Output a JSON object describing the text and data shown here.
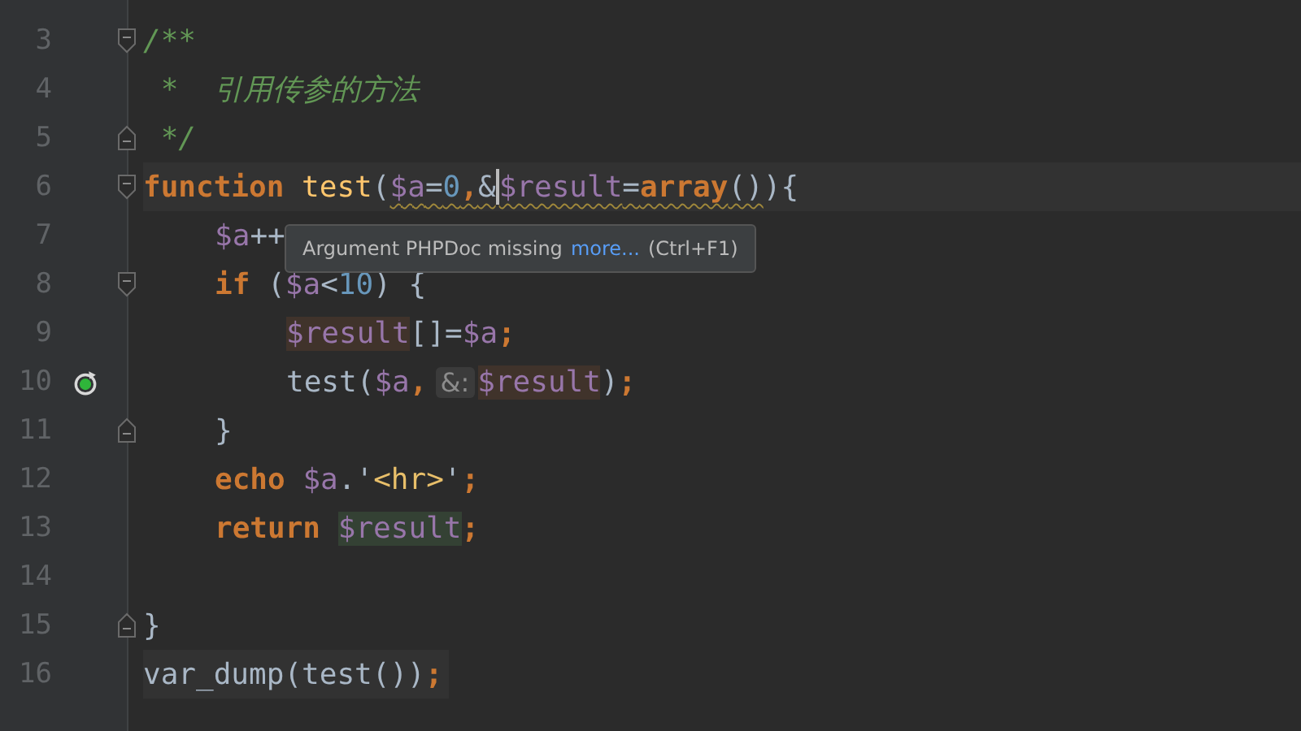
{
  "lines": [
    {
      "number": "3",
      "fold_start": true,
      "fold_end": false,
      "current": false,
      "shaded": false,
      "recursion_marker": false,
      "tokens": [
        {
          "text": "/**",
          "kind": "comment"
        }
      ]
    },
    {
      "number": "4",
      "fold_start": false,
      "fold_end": false,
      "current": false,
      "shaded": false,
      "recursion_marker": false,
      "tokens": [
        {
          "text": " *  引用传参的方法",
          "kind": "comment"
        }
      ]
    },
    {
      "number": "5",
      "fold_start": false,
      "fold_end": true,
      "current": false,
      "shaded": false,
      "recursion_marker": false,
      "tokens": [
        {
          "text": " */",
          "kind": "comment"
        }
      ]
    },
    {
      "number": "6",
      "fold_start": true,
      "fold_end": false,
      "current": true,
      "shaded": false,
      "recursion_marker": false,
      "tokens": [
        {
          "text": "function ",
          "kind": "keyword"
        },
        {
          "text": "test",
          "kind": "function"
        },
        {
          "text": "(",
          "kind": "plain"
        },
        {
          "text": "$a",
          "kind": "variable",
          "warn": true
        },
        {
          "text": "=",
          "kind": "plain",
          "warn": true
        },
        {
          "text": "0",
          "kind": "number",
          "warn": true
        },
        {
          "text": ",",
          "kind": "keyword",
          "warn": true
        },
        {
          "text": "&",
          "kind": "plain",
          "warn": true,
          "caret": true
        },
        {
          "text": "$result",
          "kind": "variable",
          "warn": true
        },
        {
          "text": "=",
          "kind": "plain",
          "warn": true
        },
        {
          "text": "array",
          "kind": "keyword",
          "warn": true
        },
        {
          "text": "()",
          "kind": "plain",
          "warn": true
        },
        {
          "text": "){",
          "kind": "plain"
        }
      ],
      "children": [
        {
          "number": "7",
          "fold_start": false,
          "fold_end": false,
          "current": false,
          "shaded": false,
          "recursion_marker": false,
          "tokens": [
            {
              "text": "$a",
              "kind": "variable"
            },
            {
              "text": "++",
              "kind": "plain"
            }
          ]
        },
        {
          "number": "8",
          "fold_start": true,
          "fold_end": false,
          "current": false,
          "shaded": false,
          "recursion_marker": false,
          "tokens": [
            {
              "text": "if",
              "kind": "keyword"
            },
            {
              "text": " (",
              "kind": "plain"
            },
            {
              "text": "$a",
              "kind": "variable"
            },
            {
              "text": "<",
              "kind": "plain"
            },
            {
              "text": "10",
              "kind": "number"
            },
            {
              "text": ") {",
              "kind": "plain"
            }
          ],
          "children": [
            {
              "number": "9",
              "fold_start": false,
              "fold_end": false,
              "current": false,
              "shaded": false,
              "recursion_marker": false,
              "tokens": [
                {
                  "text": "$result",
                  "kind": "usage"
                },
                {
                  "text": "[]=",
                  "kind": "plain"
                },
                {
                  "text": "$a",
                  "kind": "variable"
                },
                {
                  "text": ";",
                  "kind": "keyword"
                }
              ]
            },
            {
              "number": "10",
              "fold_start": false,
              "fold_end": false,
              "current": false,
              "shaded": false,
              "recursion_marker": true,
              "tokens": [
                {
                  "text": "test(",
                  "kind": "plain"
                },
                {
                  "text": "$a",
                  "kind": "variable"
                },
                {
                  "text": ",",
                  "kind": "keyword"
                },
                {
                  "text": "&:",
                  "kind": "hint"
                },
                {
                  "text": "$result",
                  "kind": "usage"
                },
                {
                  "text": ")",
                  "kind": "plain"
                },
                {
                  "text": ";",
                  "kind": "keyword"
                }
              ]
            }
          ]
        },
        {
          "number": "11",
          "fold_start": false,
          "fold_end": true,
          "current": false,
          "shaded": false,
          "recursion_marker": false,
          "tokens": [
            {
              "text": "}",
              "kind": "plain"
            }
          ]
        },
        {
          "number": "12",
          "fold_start": false,
          "fold_end": false,
          "current": false,
          "shaded": false,
          "recursion_marker": false,
          "tokens": [
            {
              "text": "echo ",
              "kind": "keyword"
            },
            {
              "text": "$a",
              "kind": "variable"
            },
            {
              "text": ".'",
              "kind": "plain"
            },
            {
              "text": "<hr>",
              "kind": "tag"
            },
            {
              "text": "'",
              "kind": "plain"
            },
            {
              "text": ";",
              "kind": "keyword"
            }
          ]
        },
        {
          "number": "13",
          "fold_start": false,
          "fold_end": false,
          "current": false,
          "shaded": false,
          "recursion_marker": false,
          "tokens": [
            {
              "text": "return ",
              "kind": "keyword"
            },
            {
              "text": "$result",
              "kind": "assignment"
            },
            {
              "text": ";",
              "kind": "keyword"
            }
          ]
        },
        {
          "number": "14",
          "fold_start": false,
          "fold_end": false,
          "current": false,
          "shaded": false,
          "recursion_marker": false
        }
      ]
    },
    {
      "number": "15",
      "fold_start": false,
      "fold_end": true,
      "current": false,
      "shaded": false,
      "recursion_marker": false,
      "tokens": [
        {
          "text": "}",
          "kind": "plain"
        }
      ]
    },
    {
      "number": "16",
      "fold_start": false,
      "fold_end": false,
      "current": false,
      "shaded": true,
      "recursion_marker": false,
      "tokens": [
        {
          "text": "var_dump(test())",
          "kind": "plain"
        },
        {
          "text": ";",
          "kind": "keyword"
        }
      ]
    }
  ],
  "tooltip": {
    "text": "Argument PHPDoc missing",
    "link": "more...",
    "shortcut": "(Ctrl+F1)"
  }
}
